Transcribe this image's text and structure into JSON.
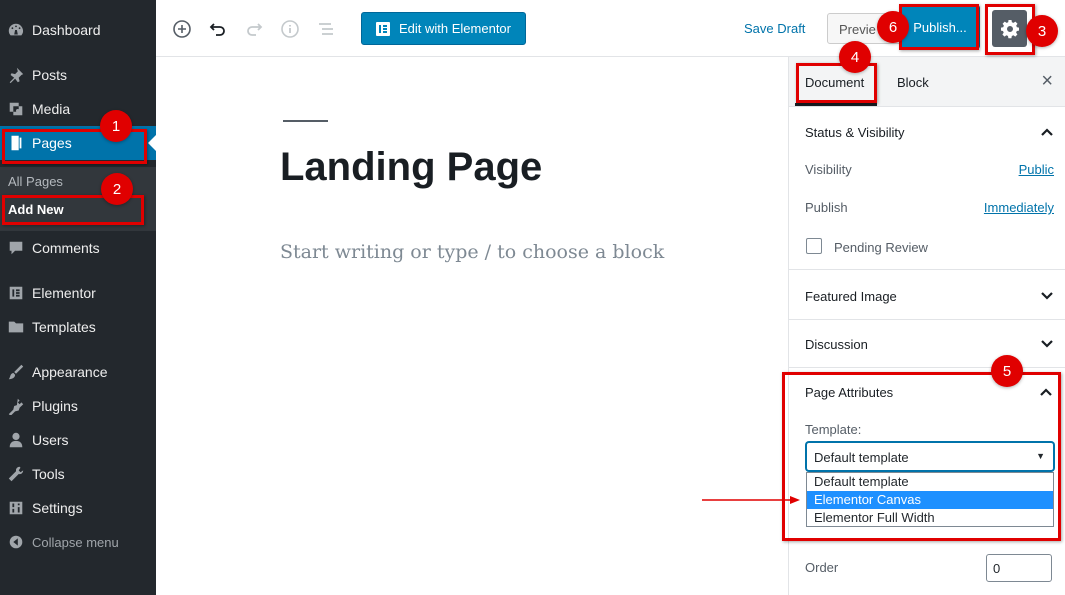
{
  "sidebar": {
    "items": [
      {
        "label": "Dashboard",
        "icon": "dashboard-icon"
      },
      {
        "label": "Posts",
        "icon": "pin-icon"
      },
      {
        "label": "Media",
        "icon": "media-icon"
      },
      {
        "label": "Pages",
        "icon": "page-icon"
      },
      {
        "label": "Comments",
        "icon": "comment-icon"
      },
      {
        "label": "Elementor",
        "icon": "elementor-icon"
      },
      {
        "label": "Templates",
        "icon": "folder-icon"
      },
      {
        "label": "Appearance",
        "icon": "brush-icon"
      },
      {
        "label": "Plugins",
        "icon": "plug-icon"
      },
      {
        "label": "Users",
        "icon": "user-icon"
      },
      {
        "label": "Tools",
        "icon": "wrench-icon"
      },
      {
        "label": "Settings",
        "icon": "settings-icon"
      }
    ],
    "submenu": {
      "all_pages": "All Pages",
      "add_new": "Add New"
    },
    "collapse": "Collapse menu"
  },
  "toolbar": {
    "elementor_label": "Edit with Elementor",
    "save_draft": "Save Draft",
    "preview": "Previe",
    "publish": "Publish..."
  },
  "editor": {
    "title": "Landing Page",
    "placeholder": "Start writing or type / to choose a block"
  },
  "panel": {
    "tabs": {
      "document": "Document",
      "block": "Block"
    },
    "close": "×",
    "status": {
      "title": "Status & Visibility",
      "visibility_label": "Visibility",
      "visibility_value": "Public",
      "publish_label": "Publish",
      "publish_value": "Immediately",
      "pending_review": "Pending Review"
    },
    "featured_image": "Featured Image",
    "discussion": "Discussion",
    "page_attributes": {
      "title": "Page Attributes",
      "template_label": "Template:",
      "selected": "Default template",
      "options": [
        "Default template",
        "Elementor Canvas",
        "Elementor Full Width"
      ],
      "highlighted_option": "Elementor Canvas",
      "order_label": "Order",
      "order_value": "0"
    }
  },
  "annotations": {
    "badges": [
      "1",
      "2",
      "3",
      "4",
      "5",
      "6"
    ],
    "color": "#e00000"
  }
}
